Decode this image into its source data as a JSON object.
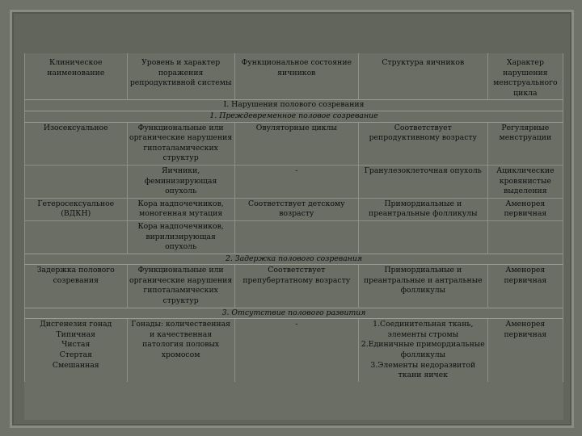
{
  "headers": [
    "Клиническое наименование",
    "Уровень и характер поражения репродуктивной системы",
    "Функциональное состояние яичников",
    "Структура яичников",
    "Характер нарушения менструального цикла"
  ],
  "sections": {
    "s1": "I. Нарушения полового созревания",
    "s1_1": "1. Преждевременное половое созревание",
    "s2": "2. Задержка полового созревания",
    "s3": "3. Отсутствие полового развития"
  },
  "rows": {
    "r1": [
      "Изосексуальное",
      "Функциональные или органические нарушения гипоталамических структур",
      "Овуляторные циклы",
      "Соответствует репродуктивному возрасту",
      "Регулярные менструации"
    ],
    "r2": [
      "",
      "Яичники, феминизирующая опухоль",
      "-",
      "Гранулезоклеточная опухоль",
      "Ациклические кровянистые выделения"
    ],
    "r3": [
      "Гетеросексуальное (ВДКН)",
      "Кора надпочечников, моногенная мутация",
      "Соответствует детскому возрасту",
      "Примордиальные и преантральные фолликулы",
      "Аменорея первичная"
    ],
    "r4": [
      "",
      "Кора надпочечников, вирилизирующая опухоль",
      "",
      "",
      ""
    ],
    "r5": [
      "Задержка полового созревания",
      "Функциональные или органические нарушения гипоталамических структур",
      "Соответствует препубертатному возрасту",
      "Примордиальные и преантральные и антральные фолликулы",
      "Аменорея первичная"
    ],
    "r6": [
      "Дисгенезия гонад\nТипичная\nЧистая\nСтертая\nСмешанная",
      "Гонады: количественная и качественная патология половых хромосом",
      "-",
      "1.Соединительная ткань, элементы стромы\n2.Единичные примордиальные фолликулы\n3.Элементы недоразвитой ткани яичек",
      "Аменорея первичная"
    ]
  }
}
